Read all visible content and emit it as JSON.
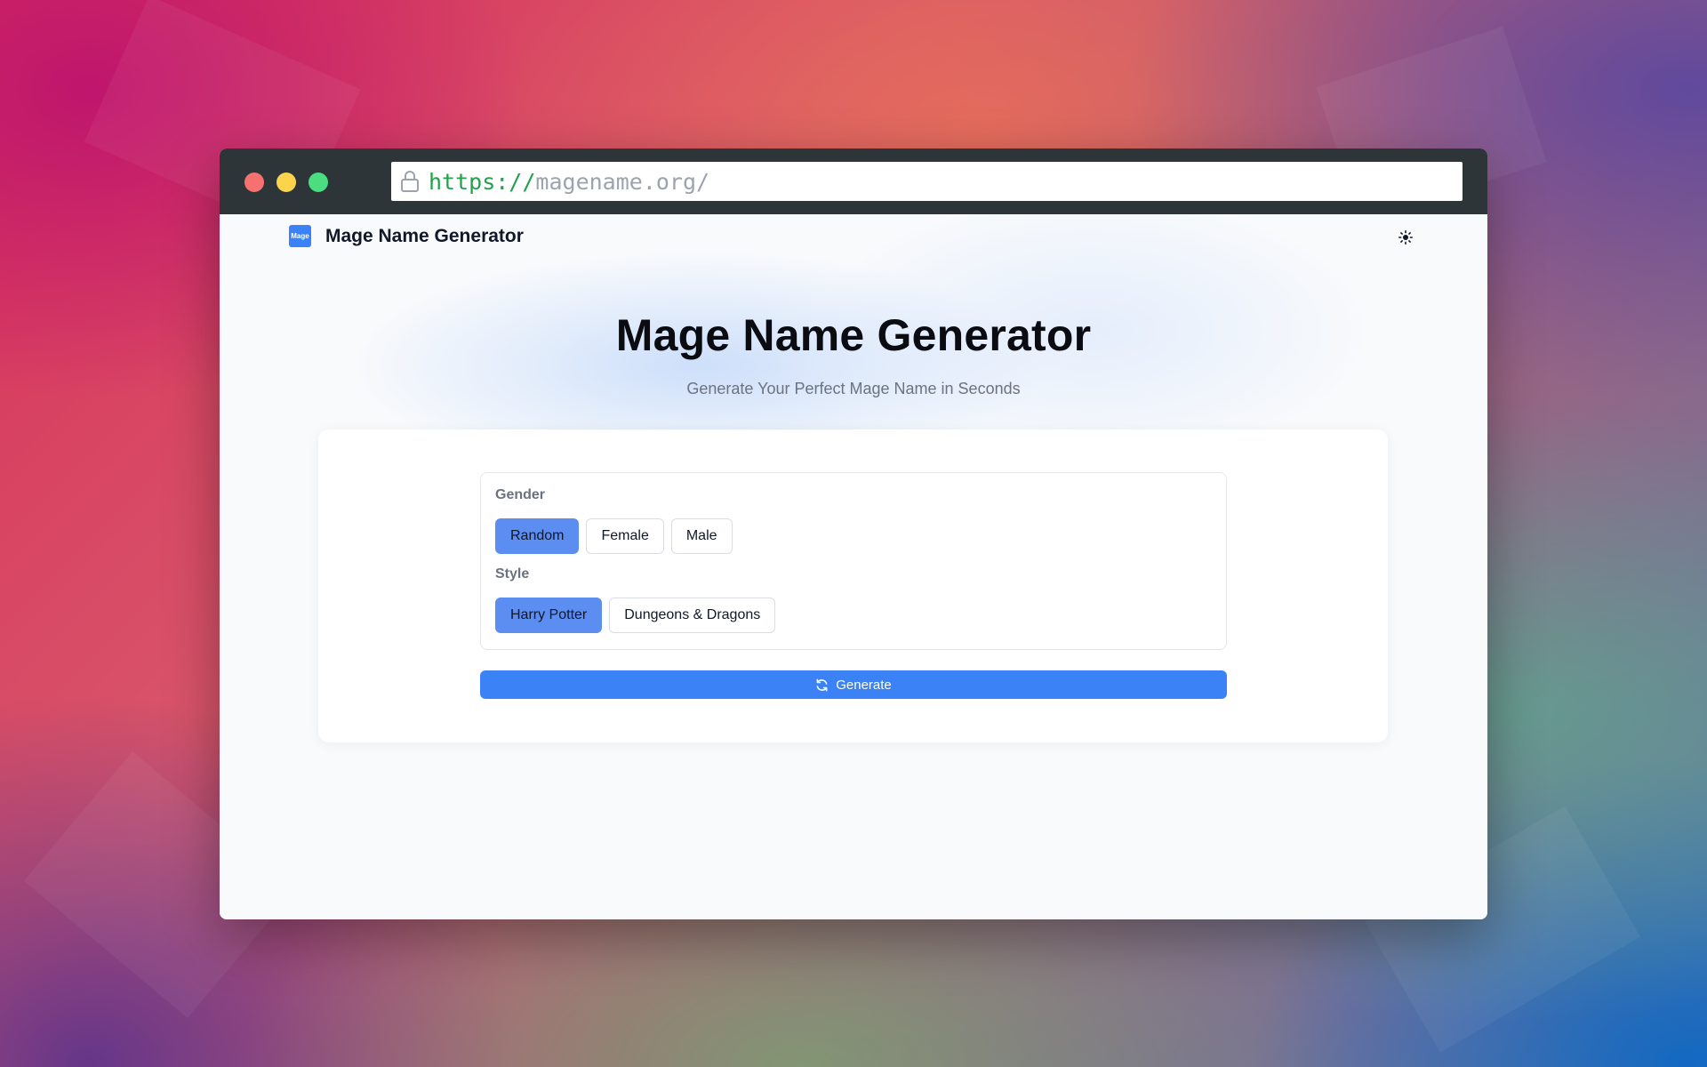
{
  "browser": {
    "url_scheme": "https://",
    "url_host": "magename.org/"
  },
  "nav": {
    "logo_text": "Mage",
    "brand": "Mage Name Generator",
    "theme_icon": "sun-icon"
  },
  "hero": {
    "title": "Mage Name Generator",
    "subtitle": "Generate Your Perfect Mage Name in Seconds"
  },
  "form": {
    "gender": {
      "label": "Gender",
      "options": [
        "Random",
        "Female",
        "Male"
      ],
      "selected": "Random"
    },
    "style": {
      "label": "Style",
      "options": [
        "Harry Potter",
        "Dungeons & Dragons"
      ],
      "selected": "Harry Potter"
    },
    "generate_label": "Generate",
    "generate_icon": "refresh-icon"
  },
  "colors": {
    "accent": "#3b82f6",
    "selected_chip": "#5b8ef0",
    "titlebar": "#2d3539",
    "url_scheme": "#22a04a"
  }
}
